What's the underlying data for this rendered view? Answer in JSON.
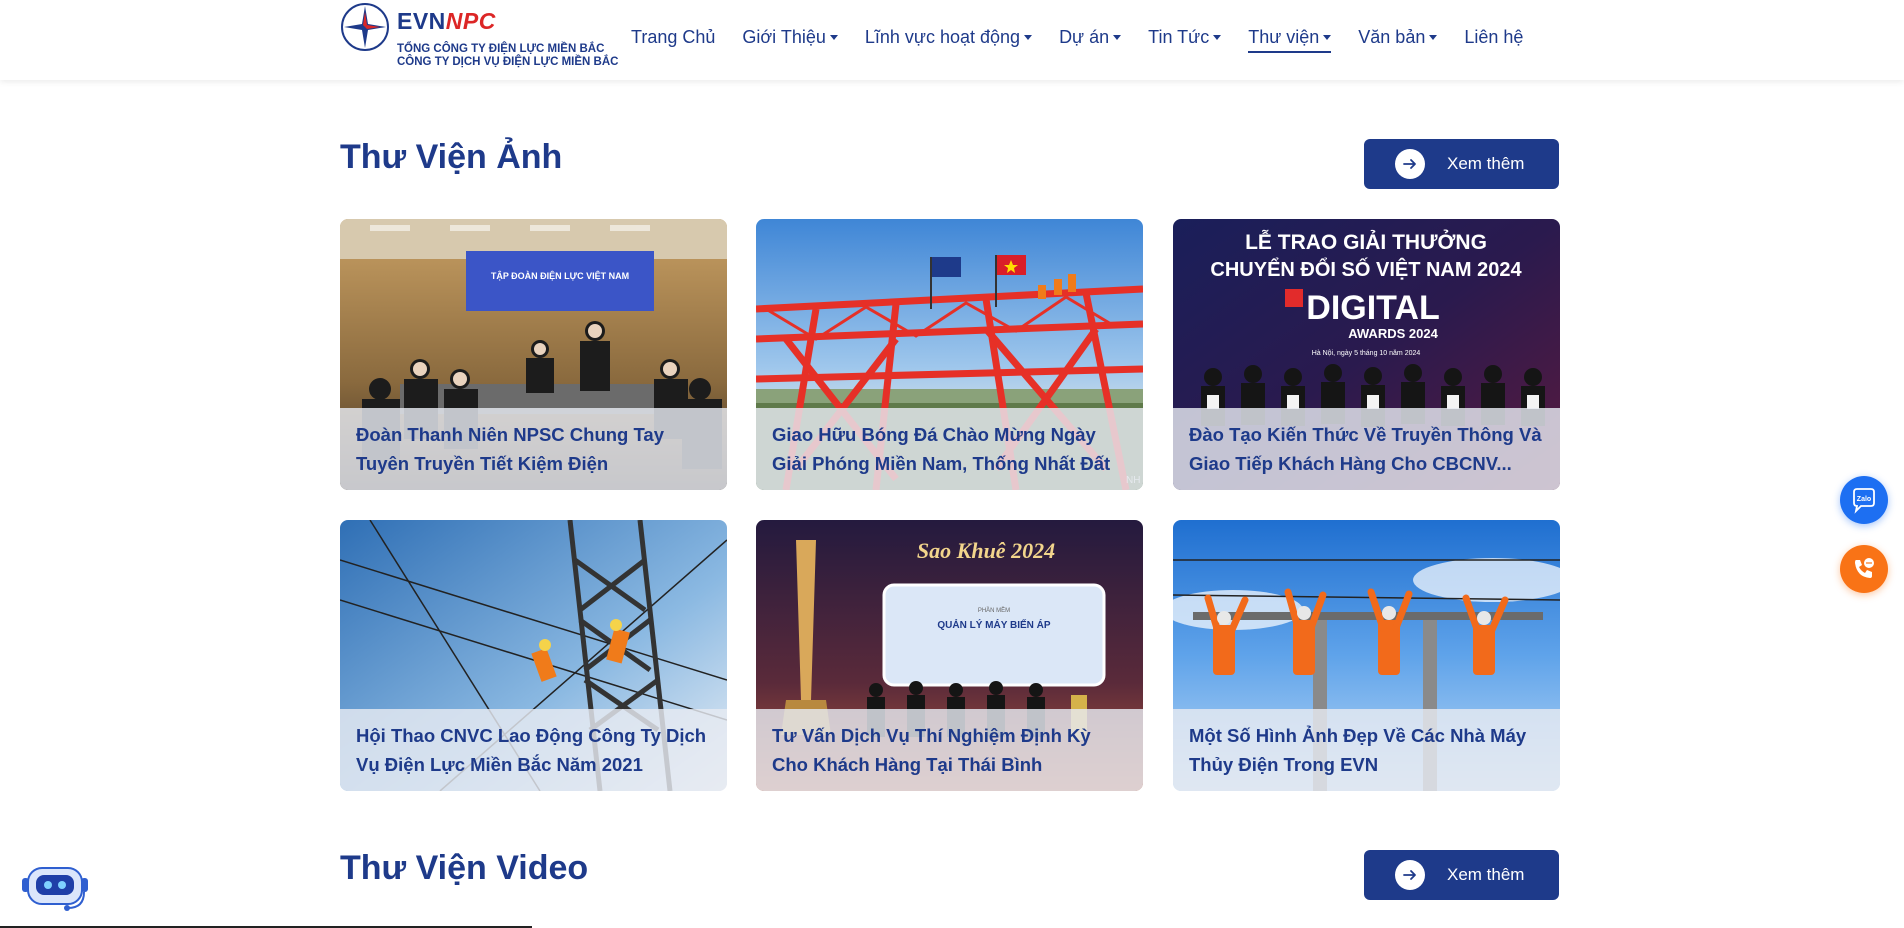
{
  "logo": {
    "brand_evn": "EVN",
    "brand_npc": "NPC",
    "line1": "TỔNG CÔNG TY ĐIỆN LỰC MIỀN BẮC",
    "line2": "CÔNG TY DỊCH VỤ ĐIỆN LỰC MIỀN BẮC"
  },
  "nav": [
    {
      "label": "Trang Chủ",
      "dropdown": false,
      "active": false
    },
    {
      "label": "Giới Thiệu",
      "dropdown": true,
      "active": false
    },
    {
      "label": "Lĩnh vực hoạt động",
      "dropdown": true,
      "active": false
    },
    {
      "label": "Dự án",
      "dropdown": true,
      "active": false
    },
    {
      "label": "Tin Tức",
      "dropdown": true,
      "active": false
    },
    {
      "label": "Thư viện",
      "dropdown": true,
      "active": true
    },
    {
      "label": "Văn bản",
      "dropdown": true,
      "active": false
    },
    {
      "label": "Liên hệ",
      "dropdown": false,
      "active": false
    }
  ],
  "photo_section": {
    "title": "Thư Viện Ảnh",
    "more_label": "Xem thêm",
    "cards": [
      {
        "title": "Đoàn Thanh Niên NPSC Chung Tay Tuyên Truyền Tiết Kiệm Điện",
        "image_text": "TẬP ĐOÀN ĐIỆN LỰC VIỆT NAM"
      },
      {
        "title": "Giao Hữu Bóng Đá Chào Mừng Ngày Giải Phóng Miền Nam, Thống Nhất Đất Nước",
        "image_text": "NH"
      },
      {
        "title": "Đào Tạo Kiến Thức Về Truyền Thông Và Giao Tiếp Khách Hàng Cho CBCNV...",
        "image_text_1": "LỄ TRAO GIẢI THƯỞNG",
        "image_text_2": "CHUYỂN ĐỔI SỐ VIỆT NAM 2024",
        "image_text_3": "DIGITAL",
        "image_text_4": "AWARDS 2024",
        "image_text_5": "Hà Nội, ngày 5 tháng 10 năm 2024"
      },
      {
        "title": "Hội Thao CNVC Lao Động Công Ty Dịch Vụ Điện Lực Miền Bắc Năm 2021"
      },
      {
        "title": "Tư Vấn Dịch Vụ Thí Nghiệm Định Kỳ Cho Khách Hàng Tại Thái Bình",
        "image_text_1": "Sao Khuê 2024",
        "image_text_2": "QUẢN LÝ MÁY BIẾN ÁP",
        "image_text_3": "PHẦN MỀM"
      },
      {
        "title": "Một Số Hình Ảnh Đẹp Về Các Nhà Máy Thủy Điện Trong EVN"
      }
    ]
  },
  "video_section": {
    "title": "Thư Viện Video",
    "more_label": "Xem thêm"
  },
  "floating": {
    "zalo_label": "Zalo",
    "colors": {
      "zalo": "#1d6ff2",
      "phone": "#f97316",
      "brand": "#1e3a8a"
    }
  }
}
